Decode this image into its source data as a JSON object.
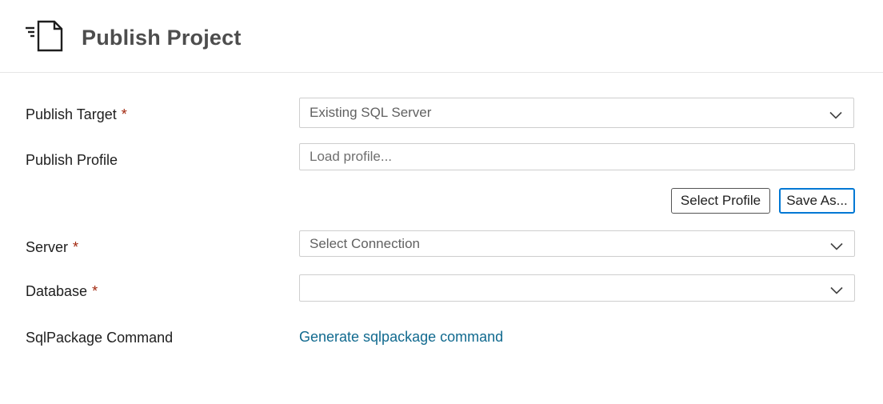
{
  "header": {
    "title": "Publish Project",
    "icon": "publish-document-icon"
  },
  "form": {
    "publish_target": {
      "label": "Publish Target",
      "required_mark": "*",
      "value": "Existing SQL Server"
    },
    "publish_profile": {
      "label": "Publish Profile",
      "placeholder": "Load profile..."
    },
    "profile_buttons": {
      "select_profile": "Select Profile",
      "save_as": "Save As..."
    },
    "server": {
      "label": "Server",
      "required_mark": "*",
      "value": "Select Connection"
    },
    "database": {
      "label": "Database",
      "required_mark": "*",
      "value": ""
    },
    "sqlpackage": {
      "label": "SqlPackage Command",
      "link": "Generate sqlpackage command"
    }
  },
  "colors": {
    "required": "#a1260d",
    "link": "#116a8f",
    "focus_border": "#0078d4",
    "field_border": "#cecece"
  }
}
